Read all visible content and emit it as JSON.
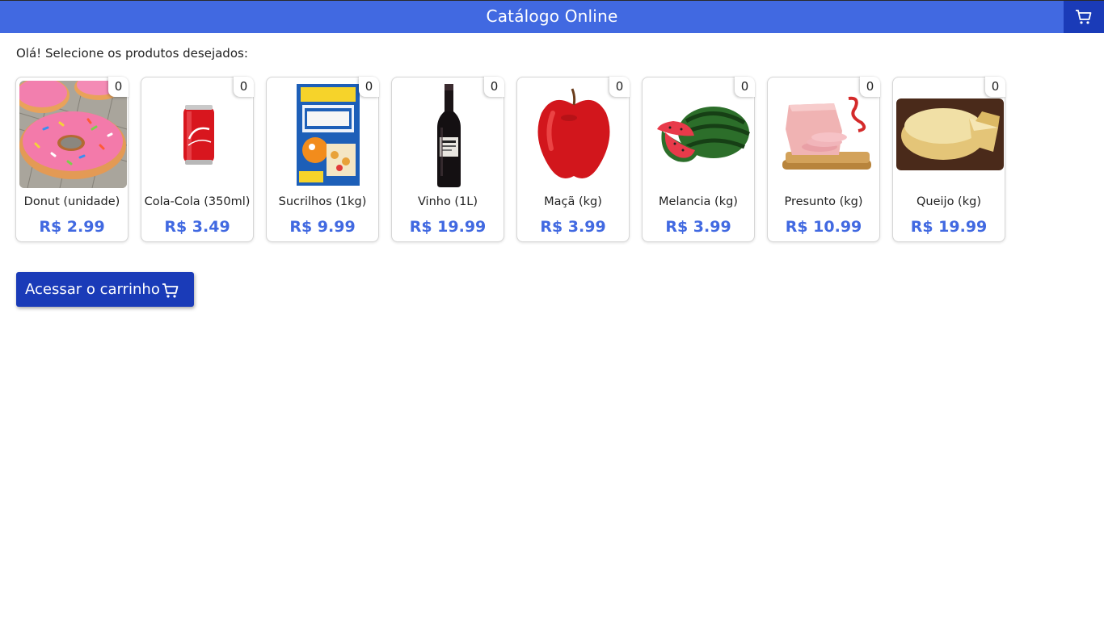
{
  "header": {
    "title": "Catálogo Online",
    "cart_icon": "cart-icon",
    "background": "#4169e1",
    "cart_background": "#1a3bb8"
  },
  "greeting": "Olá! Selecione os produtos desejados:",
  "products": [
    {
      "name": "Donut (unidade)",
      "price": "R$ 2.99",
      "quantity": "0",
      "image": "donut"
    },
    {
      "name": "Cola-Cola (350ml)",
      "price": "R$ 3.49",
      "quantity": "0",
      "image": "cola-can"
    },
    {
      "name": "Sucrilhos (1kg)",
      "price": "R$ 9.99",
      "quantity": "0",
      "image": "cereal-box"
    },
    {
      "name": "Vinho (1L)",
      "price": "R$ 19.99",
      "quantity": "0",
      "image": "wine-bottle"
    },
    {
      "name": "Maçã (kg)",
      "price": "R$ 3.99",
      "quantity": "0",
      "image": "apple"
    },
    {
      "name": "Melancia (kg)",
      "price": "R$ 3.99",
      "quantity": "0",
      "image": "watermelon"
    },
    {
      "name": "Presunto (kg)",
      "price": "R$ 10.99",
      "quantity": "0",
      "image": "ham"
    },
    {
      "name": "Queijo (kg)",
      "price": "R$ 19.99",
      "quantity": "0",
      "image": "cheese"
    }
  ],
  "cart_button": {
    "label": "Acessar o carrinho",
    "icon": "cart-icon"
  },
  "colors": {
    "accent": "#4169e1",
    "button": "#1a3bb8",
    "price": "#4169e1"
  }
}
